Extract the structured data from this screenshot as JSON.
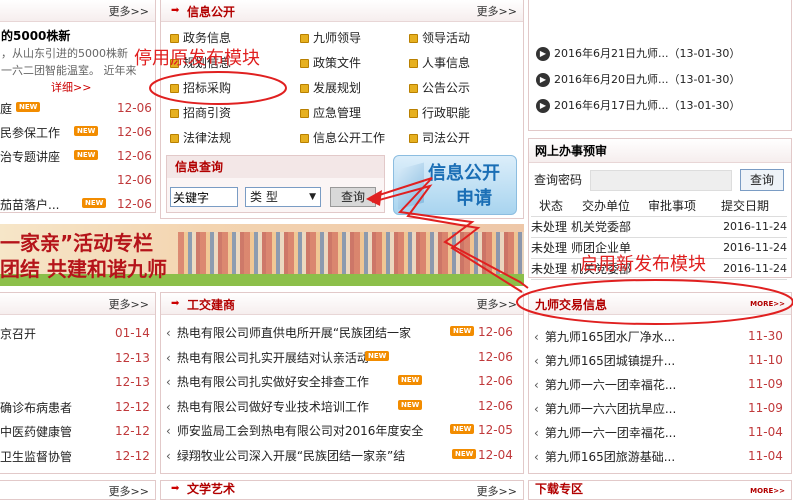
{
  "left_top": {
    "more": "更多>>",
    "headline": "的5000株新",
    "summary_1": "，从山东引进的5000株新",
    "summary_2": "一六二团智能温室。 近年来",
    "detail": "详细>>",
    "items": [
      {
        "text": "庭",
        "date": "12-06",
        "badge": "NEW"
      },
      {
        "text": "民参保工作",
        "date": "12-06",
        "badge": "NEW"
      },
      {
        "text": "治专题讲座",
        "date": "12-06",
        "badge": "NEW"
      },
      {
        "text": "",
        "date": "12-06",
        "badge": ""
      },
      {
        "text": "茄苗落户...",
        "date": "12-06",
        "badge": "NEW"
      }
    ]
  },
  "info_open": {
    "title": "信息公开",
    "more": "更多>>",
    "grid": [
      [
        "政务信息",
        "九师领导",
        "领导活动"
      ],
      [
        "规划信息",
        "政策文件",
        "人事信息"
      ],
      [
        "招标采购",
        "发展规划",
        "公告公示"
      ],
      [
        "招商引资",
        "应急管理",
        "行政职能"
      ],
      [
        "法律法规",
        "信息公开工作",
        "司法公开"
      ]
    ],
    "query_title": "信息查询",
    "keyword_value": "关键字",
    "type_value": "类 型",
    "query_button": "查询",
    "apply_line1": "信息公开",
    "apply_line2": "申请"
  },
  "right_top": {
    "items": [
      "2016年6月21日九师...（13-01-30）",
      "2016年6月20日九师...（13-01-30）",
      "2016年6月17日九师...（13-01-30）"
    ]
  },
  "online": {
    "title": "网上办事预审",
    "password_label": "查询密码",
    "query_button": "查询",
    "headers": [
      "状态",
      "交办单位",
      "审批事项",
      "提交日期"
    ],
    "rows": [
      [
        "未处理",
        "机关党委部",
        "",
        "2016-11-24"
      ],
      [
        "未处理",
        "师团企业单",
        "",
        "2016-11-24"
      ],
      [
        "未处理",
        "机关党委部",
        "",
        "2016-11-24"
      ]
    ]
  },
  "banner": {
    "line1": "一家亲”活动专栏",
    "line2": "团结 共建和谐九师"
  },
  "left_bottom": {
    "more": "更多>>",
    "items": [
      {
        "text": "京召开",
        "date": "01-14"
      },
      {
        "text": "",
        "date": "12-13"
      },
      {
        "text": "",
        "date": "12-13"
      },
      {
        "text": "确诊布病患者",
        "date": "12-12"
      },
      {
        "text": "中医药健康管",
        "date": "12-12"
      },
      {
        "text": "卫生监督协管",
        "date": "12-12"
      }
    ]
  },
  "gongjiao": {
    "title": "工交建商",
    "more": "更多>>",
    "items": [
      {
        "text": "热电有限公司师直供电所开展“民族团结一家",
        "date": "12-06"
      },
      {
        "text": "热电有限公司扎实开展结对认亲活动",
        "date": "12-06"
      },
      {
        "text": "热电有限公司扎实做好安全排查工作",
        "date": "12-06"
      },
      {
        "text": "热电有限公司做好专业技术培训工作",
        "date": "12-06"
      },
      {
        "text": "师安监局工会到热电有限公司对2016年度安全",
        "date": "12-05"
      },
      {
        "text": "绿翔牧业公司深入开展“民族团结一家亲”结",
        "date": "12-04"
      }
    ]
  },
  "trade": {
    "title": "九师交易信息",
    "more": "MORE>>",
    "items": [
      {
        "text": "第九师165团水厂净水...",
        "date": "11-30"
      },
      {
        "text": "第九师165团城镇提升...",
        "date": "11-10"
      },
      {
        "text": "第九师一六一团幸福花...",
        "date": "11-09"
      },
      {
        "text": "第九师一六六团抗旱应...",
        "date": "11-09"
      },
      {
        "text": "第九师一六一团幸福花...",
        "date": "11-04"
      },
      {
        "text": "第九师165团旅游基础...",
        "date": "11-04"
      }
    ]
  },
  "bottom": {
    "more_left": "更多>>",
    "more_mid": "更多>>",
    "mid_title": "文学艺术",
    "right_title": "下载专区",
    "more_right": "MORE>>"
  },
  "annotations": {
    "disabled": "停用原发布模块",
    "enabled": "启用新发布模块"
  },
  "colors": {
    "accent": "#b20000",
    "date": "#c0393b",
    "annotation": "#e02020",
    "badge": "#f28c00"
  }
}
